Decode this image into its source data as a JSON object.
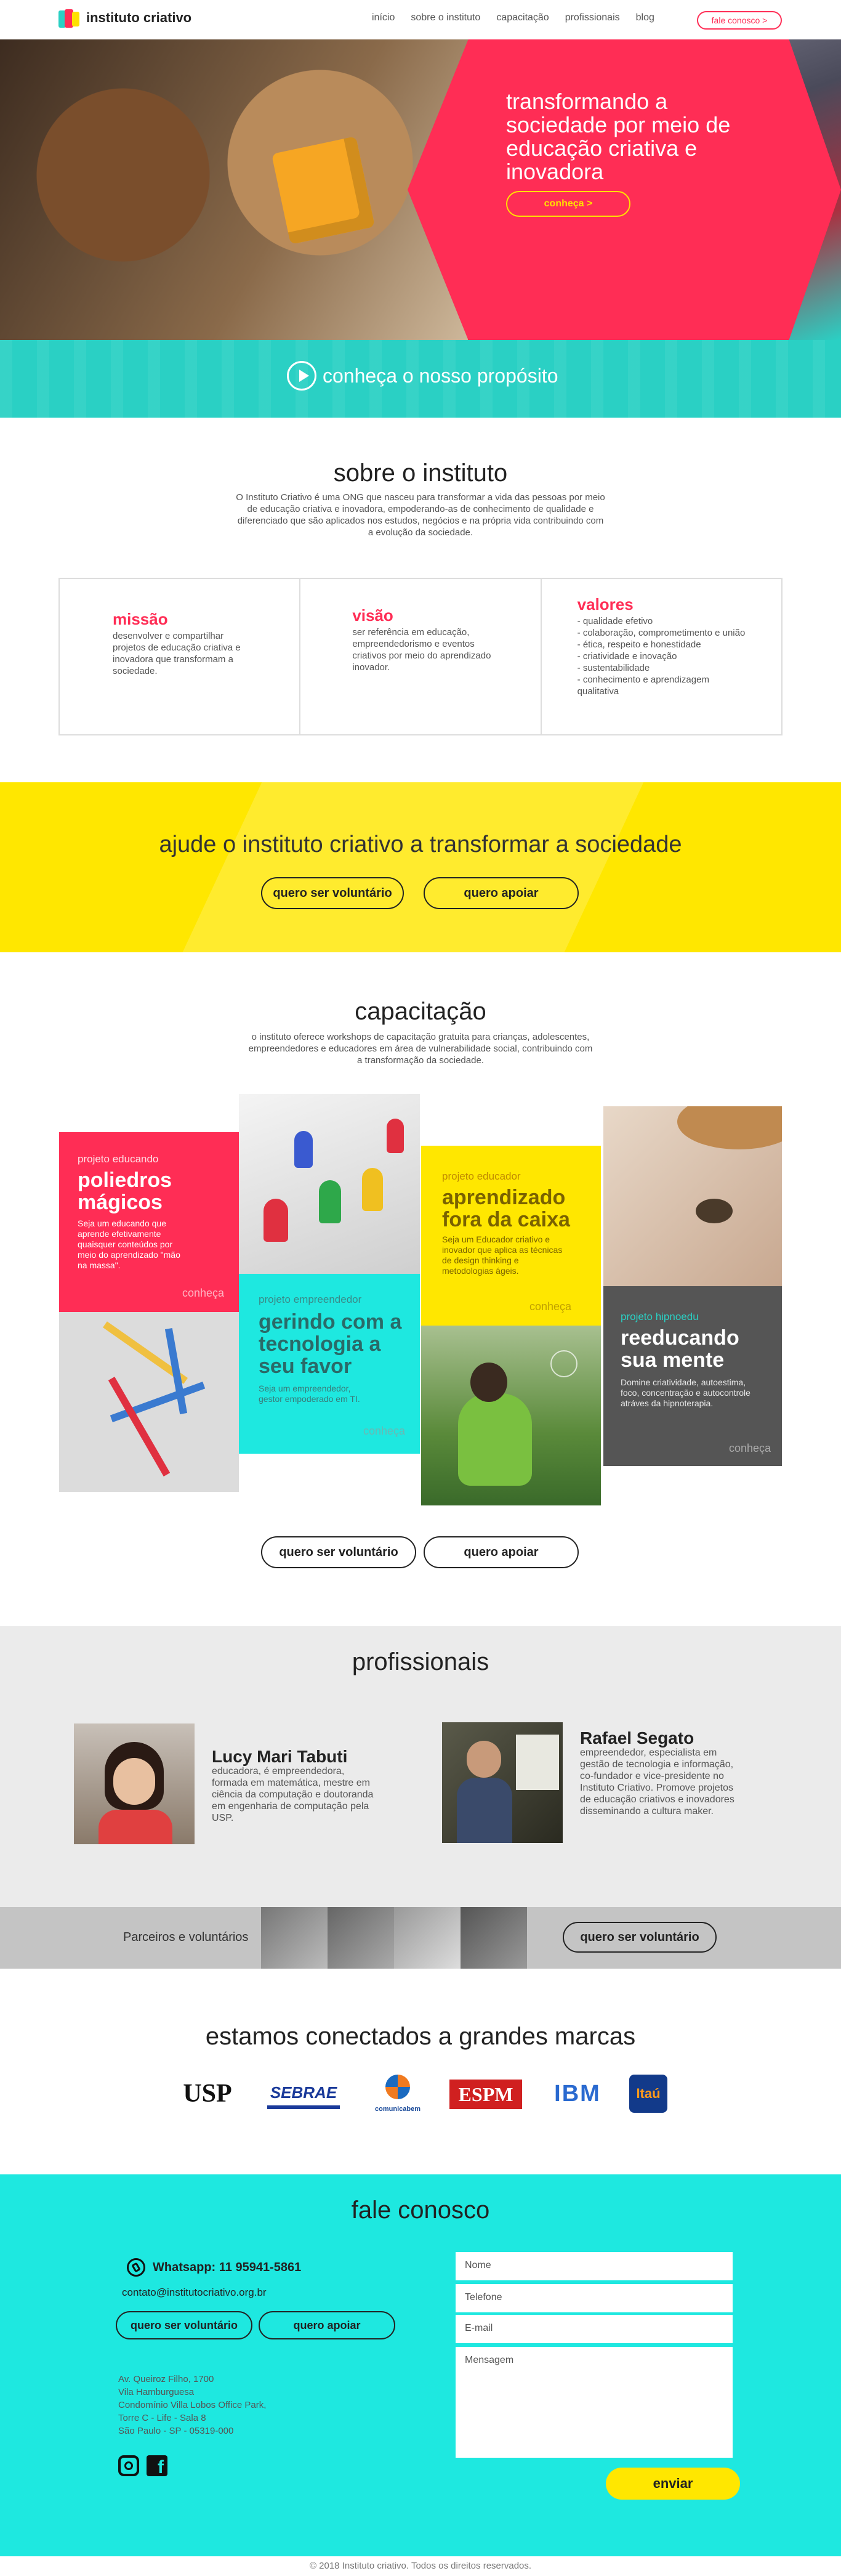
{
  "nav": {
    "logo_text": "instituto criativo",
    "items": [
      "início",
      "sobre o instituto",
      "capacitação",
      "profissionais",
      "blog"
    ],
    "cta": "fale conosco >"
  },
  "hero": {
    "title": "transformando a sociedade por meio de educação criativa e inovadora",
    "button": "conheça >"
  },
  "purpose": {
    "text": "conheça o nosso propósito"
  },
  "sobre": {
    "title": "sobre o instituto",
    "lead": "O Instituto Criativo é uma ONG que nasceu para transformar a vida das pessoas por meio de educação criativa e inovadora, empoderando-as de conhecimento de qualidade e diferenciado que são aplicados nos estudos, negócios e na própria vida contribuindo com a evolução da sociedade.",
    "cards": [
      {
        "title": "missão",
        "text": "desenvolver e compartilhar projetos de educação criativa e inovadora que transformam a sociedade."
      },
      {
        "title": "visão",
        "text": "ser referência em educação, empreendedorismo e eventos criativos por meio do aprendizado inovador."
      },
      {
        "title": "valores",
        "text": "- qualidade efetivo\n- colaboração, comprometimento e união\n- ética, respeito e honestidade\n- criatividade e inovação\n- sustentabilidade\n- conhecimento e aprendizagem qualitativa"
      }
    ]
  },
  "help": {
    "title": "ajude o instituto criativo a transformar a sociedade",
    "volunteer": "quero ser voluntário",
    "support": "quero apoiar"
  },
  "capacitacao": {
    "title": "capacitação",
    "lead": "o instituto oferece workshops de capacitação gratuita para crianças, adolescentes, empreendedores e educadores em área de vulnerabilidade social, contribuindo com a transformação da sociedade.",
    "projects": [
      {
        "label": "projeto educando",
        "title": "poliedros mágicos",
        "text": "Seja um educando que aprende efetivamente quaisquer conteúdos por meio do aprendizado \"mão na massa\".",
        "more": "conheça",
        "color": "#ff2d55"
      },
      {
        "label": "projeto empreendedor",
        "title": "gerindo com a tecnologia a seu favor",
        "text": "Seja um empreendedor, gestor empoderado em TI.",
        "more": "conheça",
        "color": "#1ee8e0"
      },
      {
        "label": "projeto educador",
        "title": "aprendizado fora da caixa",
        "text": "Seja um Educador criativo e inovador que aplica as técnicas de design thinking e metodologias ágeis.",
        "more": "conheça",
        "color": "#ffe700"
      },
      {
        "label": "projeto hipnoedu",
        "title": "reeducando sua mente",
        "text": "Domine criatividade, autoestima, foco, concentração e autocontrole atráves da hipnoterapia.",
        "more": "conheça",
        "color": "#555555"
      }
    ],
    "volunteer": "quero ser voluntário",
    "support": "quero apoiar"
  },
  "profissionais": {
    "title": "profissionais",
    "people": [
      {
        "name": "Lucy Mari Tabuti",
        "text": "educadora, é empreendedora, formada em matemática, mestre em ciência da computação e doutoranda em engenharia de computação pela USP."
      },
      {
        "name": "Rafael Segato",
        "text": "empreendedor, especialista em gestão de tecnologia e informação, co-fundador e vice-presidente no Instituto Criativo. Promove projetos de educação criativos e inovadores disseminando a cultura maker."
      }
    ]
  },
  "partners": {
    "text": "Parceiros e voluntários",
    "button": "quero ser voluntário"
  },
  "brands": {
    "title": "estamos conectados a grandes marcas",
    "items": [
      "USP",
      "SEBRAE",
      "comunicabem",
      "ESPM",
      "IBM",
      "Itaú"
    ]
  },
  "contact": {
    "title": "fale conosco",
    "whatsapp": "Whatsapp: 11 95941-5861",
    "email": "contato@institutocriativo.org.br",
    "volunteer": "quero ser voluntário",
    "support": "quero apoiar",
    "address": "Av. Queiroz Filho, 1700\nVila Hamburguesa\nCondomínio Villa Lobos Office Park,\nTorre C - Life - Sala 8\nSão Paulo - SP - 05319-000",
    "fields": {
      "name": "Nome",
      "phone": "Telefone",
      "email": "E-mail",
      "message": "Mensagem"
    },
    "send": "enviar"
  },
  "footer": {
    "text": "© 2018 Instituto criativo. Todos os direitos reservados."
  },
  "colors": {
    "red": "#ff2d55",
    "yellow": "#ffe700",
    "cyan": "#1ee8e0",
    "teal": "#2ad0c4"
  }
}
